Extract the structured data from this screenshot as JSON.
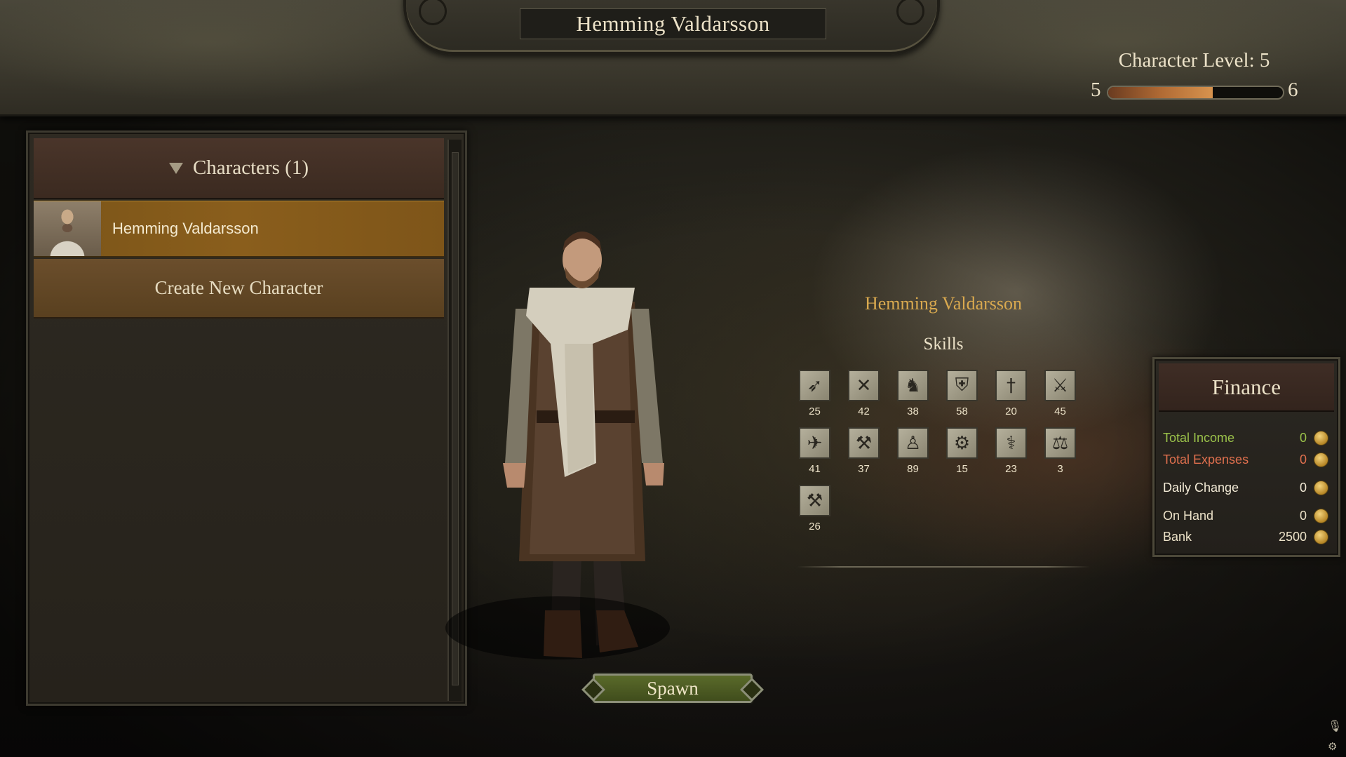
{
  "header": {
    "character_name": "Hemming Valdarsson",
    "level_label": "Character Level: 5",
    "level_min": "5",
    "level_max": "6",
    "level_progress": 0.6
  },
  "characters_panel": {
    "header": "Characters (1)",
    "characters": [
      {
        "name": "Hemming Valdarsson"
      }
    ],
    "create_label": "Create New Character"
  },
  "spawn_label": "Spawn",
  "info": {
    "name": "Hemming Valdarsson",
    "skills_title": "Skills",
    "skills": [
      {
        "icon": "bow-icon",
        "glyph": "➶",
        "value": "25"
      },
      {
        "icon": "crossbow-icon",
        "glyph": "✕",
        "value": "42"
      },
      {
        "icon": "riding-icon",
        "glyph": "♞",
        "value": "38"
      },
      {
        "icon": "shield-icon",
        "glyph": "⛨",
        "value": "58"
      },
      {
        "icon": "one-handed-icon",
        "glyph": "†",
        "value": "20"
      },
      {
        "icon": "polearm-icon",
        "glyph": "⚔",
        "value": "45"
      },
      {
        "icon": "throwing-icon",
        "glyph": "✈",
        "value": "41"
      },
      {
        "icon": "two-handed-icon",
        "glyph": "⚒",
        "value": "37"
      },
      {
        "icon": "athletics-icon",
        "glyph": "♙",
        "value": "89"
      },
      {
        "icon": "engineering-icon",
        "glyph": "⚙",
        "value": "15"
      },
      {
        "icon": "medicine-icon",
        "glyph": "⚕",
        "value": "23"
      },
      {
        "icon": "trade-icon",
        "glyph": "⚖",
        "value": "3"
      },
      {
        "icon": "smithing-icon",
        "glyph": "⚒",
        "value": "26"
      }
    ]
  },
  "finance": {
    "title": "Finance",
    "rows": [
      {
        "label": "Total Income",
        "value": "0",
        "color": "#9bc24a"
      },
      {
        "label": "Total Expenses",
        "value": "0",
        "color": "#e0704e"
      },
      {
        "label": "Daily Change",
        "value": "0",
        "color": "#f2ead6"
      },
      {
        "label": "On Hand",
        "value": "0",
        "color": "#ece2c8"
      },
      {
        "label": "Bank",
        "value": "2500",
        "color": "#ece2c8"
      }
    ]
  },
  "colors": {
    "accent_gold": "#d9a94f",
    "selected_row": "#8a5e1c",
    "spawn_green": "#4f5f24"
  }
}
